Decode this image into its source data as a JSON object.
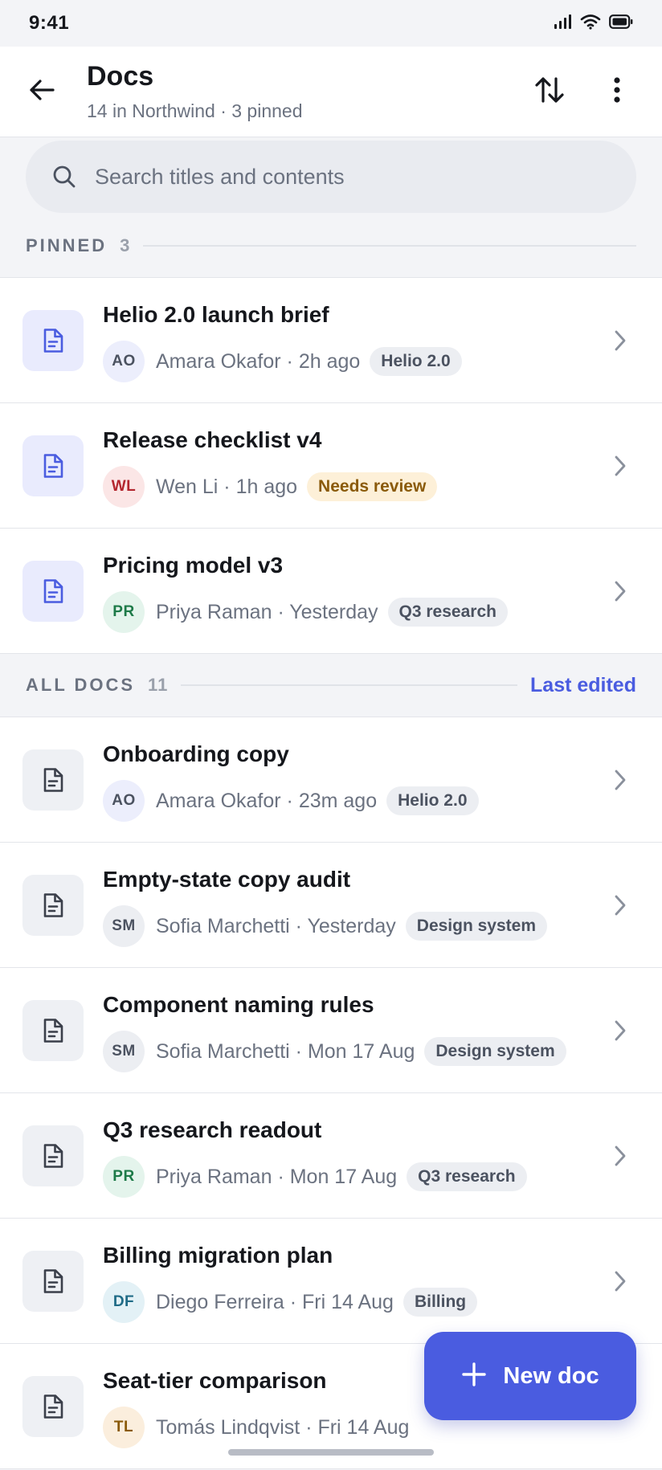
{
  "status_bar": {
    "time": "9:41"
  },
  "header": {
    "title": "Docs",
    "subtitle": "14 in Northwind · 3 pinned"
  },
  "search": {
    "placeholder": "Search titles and contents"
  },
  "pinned": {
    "title": "PINNED",
    "count": "3",
    "items": [
      {
        "title": "Helio 2.0 launch brief",
        "initials": "AO",
        "avatar_bg": "#eceefc",
        "avatar_fg": "#4b5260",
        "meta": "Amara Okafor · 2h ago",
        "tag": "Helio 2.0",
        "tag_style": "neutral"
      },
      {
        "title": "Release checklist v4",
        "initials": "WL",
        "avatar_bg": "#fbe6e6",
        "avatar_fg": "#b3262e",
        "meta": "Wen Li · 1h ago",
        "tag": "Needs review",
        "tag_style": "warn"
      },
      {
        "title": "Pricing model v3",
        "initials": "PR",
        "avatar_bg": "#e4f4ec",
        "avatar_fg": "#1d7a48",
        "meta": "Priya Raman · Yesterday",
        "tag": "Q3 research",
        "tag_style": "neutral"
      }
    ]
  },
  "all_docs": {
    "title": "ALL DOCS",
    "count": "11",
    "sort_label": "Last edited",
    "items": [
      {
        "title": "Onboarding copy",
        "initials": "AO",
        "avatar_bg": "#eceefc",
        "avatar_fg": "#4b5260",
        "meta": "Amara Okafor · 23m ago",
        "tag": "Helio 2.0",
        "tag_style": "neutral"
      },
      {
        "title": "Empty-state copy audit",
        "initials": "SM",
        "avatar_bg": "#eceef2",
        "avatar_fg": "#4b5260",
        "meta": "Sofia Marchetti · Yesterday",
        "tag": "Design system",
        "tag_style": "neutral"
      },
      {
        "title": "Component naming rules",
        "initials": "SM",
        "avatar_bg": "#eceef2",
        "avatar_fg": "#4b5260",
        "meta": "Sofia Marchetti · Mon 17 Aug",
        "tag": "Design system",
        "tag_style": "neutral"
      },
      {
        "title": "Q3 research readout",
        "initials": "PR",
        "avatar_bg": "#e4f4ec",
        "avatar_fg": "#1d7a48",
        "meta": "Priya Raman · Mon 17 Aug",
        "tag": "Q3 research",
        "tag_style": "neutral"
      },
      {
        "title": "Billing migration plan",
        "initials": "DF",
        "avatar_bg": "#e3f1f6",
        "avatar_fg": "#1f6b86",
        "meta": "Diego Ferreira · Fri 14 Aug",
        "tag": "Billing",
        "tag_style": "neutral"
      },
      {
        "title": "Seat-tier comparison",
        "initials": "TL",
        "avatar_bg": "#fbeedd",
        "avatar_fg": "#8a5a0a",
        "meta": "Tomás Lindqvist · Fri 14 Aug",
        "tag": "",
        "tag_style": "neutral"
      }
    ]
  },
  "fab": {
    "label": "New doc"
  },
  "colors": {
    "accent": "#4a5ce0",
    "background": "#f3f4f7",
    "surface": "#ffffff"
  },
  "icons": [
    "signal-icon",
    "wifi-icon",
    "battery-icon",
    "back-arrow-icon",
    "sort-icon",
    "more-vertical-icon",
    "search-icon",
    "document-icon",
    "chevron-right-icon",
    "plus-icon"
  ]
}
